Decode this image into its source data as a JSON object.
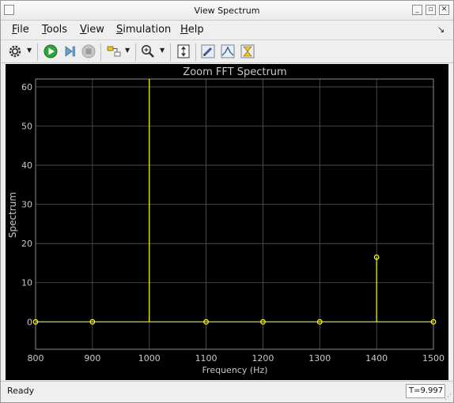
{
  "window": {
    "title": "View Spectrum"
  },
  "menubar": {
    "items": [
      {
        "label": "File",
        "mnemonic": "F",
        "rest": "ile"
      },
      {
        "label": "Tools",
        "mnemonic": "T",
        "rest": "ools"
      },
      {
        "label": "View",
        "mnemonic": "V",
        "rest": "iew"
      },
      {
        "label": "Simulation",
        "mnemonic": "S",
        "rest": "imulation"
      },
      {
        "label": "Help",
        "mnemonic": "H",
        "rest": "elp"
      }
    ]
  },
  "toolbar": {
    "icons": [
      "gear-icon",
      "run-icon",
      "step-forward-icon",
      "stop-icon",
      "highlight-block-icon",
      "zoom-in-icon",
      "scale-axes-icon",
      "edit-icon",
      "peak-finder-icon",
      "cursor-measure-icon"
    ]
  },
  "status": {
    "text": "Ready",
    "time": "T=9.997"
  },
  "chart_data": {
    "type": "line",
    "title": "Zoom FFT Spectrum",
    "xlabel": "Frequency (Hz)",
    "ylabel": "Spectrum",
    "xlim": [
      800,
      1500
    ],
    "ylim": [
      -7,
      62
    ],
    "x_ticks": [
      800,
      900,
      1000,
      1100,
      1200,
      1300,
      1400,
      1500
    ],
    "y_ticks": [
      0,
      10,
      20,
      30,
      40,
      50,
      60
    ],
    "grid": true,
    "line_color": "#ffff00",
    "background": "#000000",
    "series": [
      {
        "x": [
          800,
          900,
          1000,
          1100,
          1200,
          1300,
          1400,
          1500
        ],
        "y": [
          0,
          0,
          62,
          0,
          0,
          0,
          16.5,
          0
        ],
        "markers": [
          true,
          true,
          false,
          true,
          true,
          true,
          true,
          true
        ]
      }
    ]
  }
}
